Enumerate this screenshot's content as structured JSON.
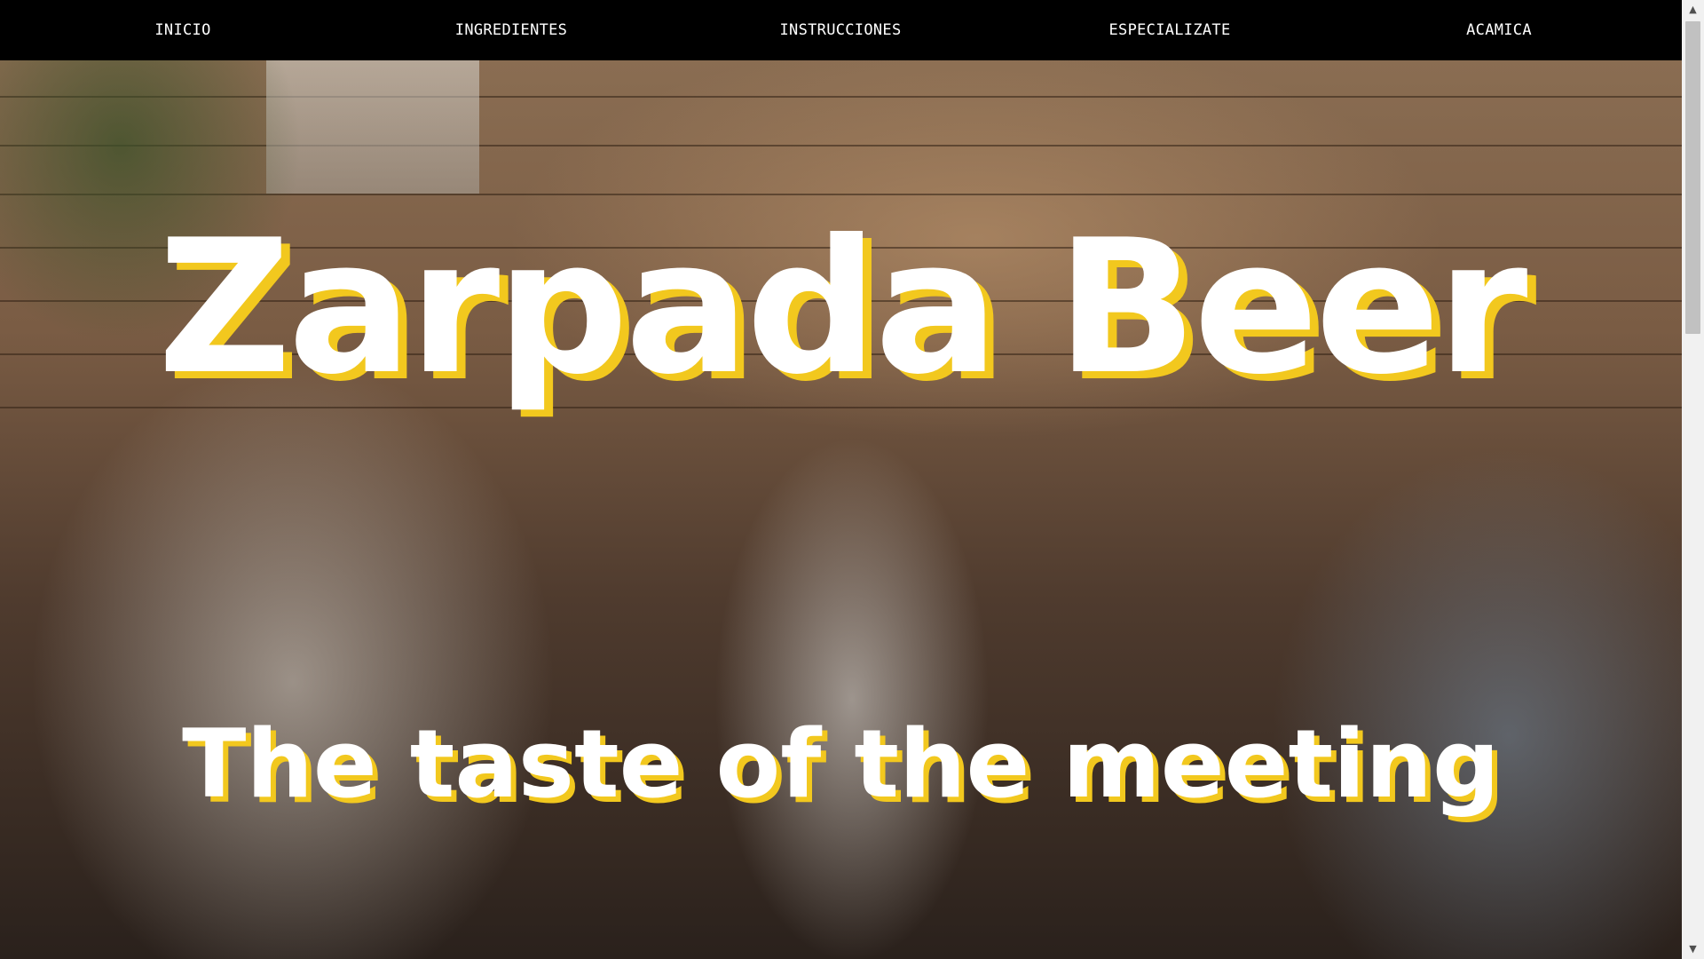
{
  "nav": {
    "items": [
      {
        "label": "INICIO"
      },
      {
        "label": "INGREDIENTES"
      },
      {
        "label": "INSTRUCCIONES"
      },
      {
        "label": "ESPECIALIZATE"
      },
      {
        "label": "ACAMICA"
      }
    ]
  },
  "hero": {
    "title": "Zarpada Beer",
    "subtitle": "The taste of the meeting"
  },
  "scrollbar": {
    "up_icon": "▲",
    "down_icon": "▼"
  },
  "colors": {
    "navbar_bg": "#000000",
    "nav_text": "#ffffff",
    "accent_shadow": "#f2c81e",
    "title_text": "#ffffff"
  }
}
